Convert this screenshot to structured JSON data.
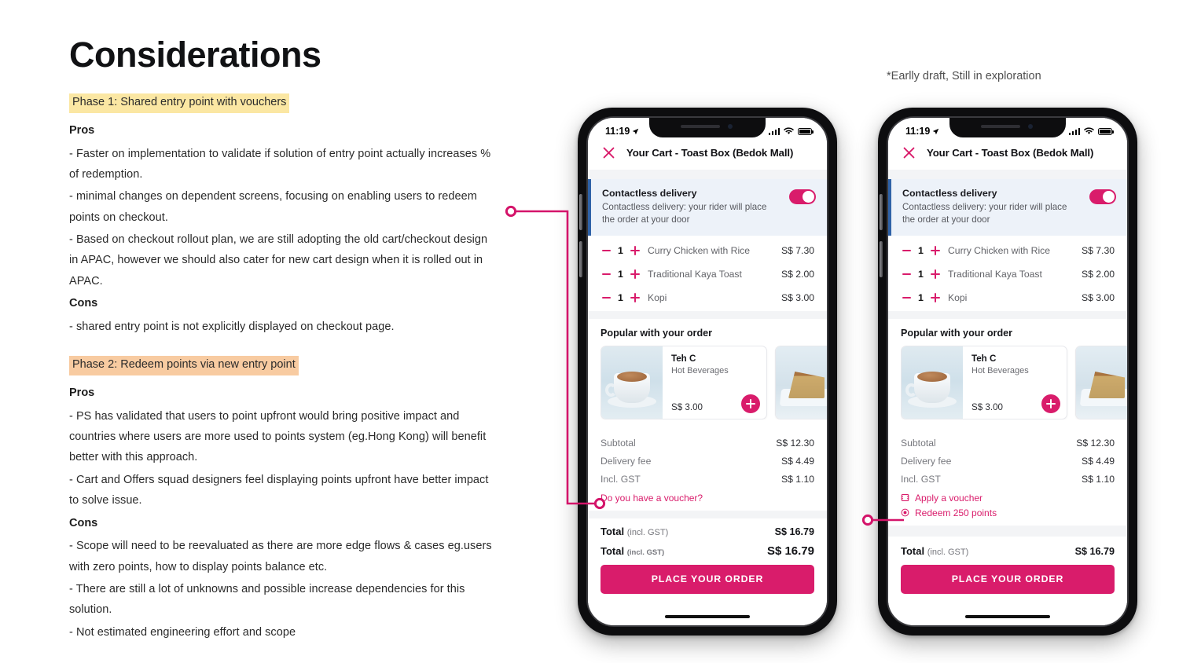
{
  "page": {
    "title": "Considerations",
    "draft_note": "*Earlly draft, Still in exploration",
    "accent_pink": "#D91C6B",
    "highlight_yellow": "#FBE7A3",
    "highlight_orange": "#F8CBA1",
    "banner_blue": "#2F62A8"
  },
  "phase1": {
    "label": "Phase 1: Shared entry point with vouchers",
    "pros_heading": "Pros",
    "pros": [
      "- Faster on implementation to validate if solution of entry point actually increases % of redemption.",
      "- minimal changes on dependent screens, focusing on enabling users to redeem points on checkout.",
      "- Based on checkout rollout plan, we are still adopting the old cart/checkout design in APAC, however we should also cater for new cart design when it is rolled out in APAC."
    ],
    "cons_heading": "Cons",
    "cons": [
      "-  shared entry point is not explicitly displayed on checkout page."
    ]
  },
  "phase2": {
    "label": "Phase 2: Redeem points via new entry point",
    "pros_heading": "Pros",
    "pros": [
      "- PS has validated that users to point upfront would bring positive impact and countries where users are more used to points system (eg.Hong Kong) will benefit better with this approach.",
      "- Cart and Offers squad designers feel displaying points upfront have better impact to solve issue."
    ],
    "cons_heading": "Cons",
    "cons": [
      "- Scope will need to be reevaluated as there are more edge flows & cases eg.users with zero points, how to display points balance etc.",
      "- There are still a lot of unknowns and possible increase dependencies for this solution.",
      "- Not estimated engineering effort and scope"
    ]
  },
  "phone1": {
    "status": {
      "time": "11:19",
      "location_icon": "location-arrow-icon",
      "signal_icon": "cellular-signal-icon",
      "wifi_icon": "wifi-icon",
      "battery_icon": "battery-icon"
    },
    "header": {
      "close_icon": "close-x-icon",
      "title": "Your Cart - Toast Box (Bedok Mall)"
    },
    "contactless": {
      "title": "Contactless delivery",
      "desc": "Contactless delivery: your rider will place the order at your door",
      "toggle_on": "true"
    },
    "items": [
      {
        "qty": "1",
        "name": "Curry Chicken with Rice",
        "price": "S$ 7.30"
      },
      {
        "qty": "1",
        "name": "Traditional Kaya Toast",
        "price": "S$ 2.00"
      },
      {
        "qty": "1",
        "name": "Kopi",
        "price": "S$ 3.00"
      }
    ],
    "popular": {
      "title": "Popular with your order",
      "cards": [
        {
          "name": "Teh C",
          "category": "Hot Beverages",
          "price": "S$ 3.00",
          "image": "hot-tea-cup-image"
        },
        {
          "name": "",
          "category": "",
          "price": "",
          "image": "cake-slice-image"
        }
      ]
    },
    "summary": [
      {
        "label": "Subtotal",
        "value": "S$ 12.30"
      },
      {
        "label": "Delivery fee",
        "value": "S$ 4.49"
      },
      {
        "label": "Incl. GST",
        "value": "S$ 1.10"
      }
    ],
    "voucher_link": "Do you have a voucher?",
    "total_row_1": {
      "label": "Total",
      "sub": "(incl. GST)",
      "value": "S$ 16.79"
    },
    "total_row_2": {
      "label": "Total",
      "sub": "(incl. GST)",
      "value": "S$ 16.79"
    },
    "cta": "PLACE YOUR ORDER"
  },
  "phone2": {
    "status": {
      "time": "11:19",
      "location_icon": "location-arrow-icon",
      "signal_icon": "cellular-signal-icon",
      "wifi_icon": "wifi-icon",
      "battery_icon": "battery-icon"
    },
    "header": {
      "close_icon": "close-x-icon",
      "title": "Your Cart - Toast Box (Bedok Mall)"
    },
    "contactless": {
      "title": "Contactless delivery",
      "desc": "Contactless delivery: your rider will place the order at your door",
      "toggle_on": "true"
    },
    "items": [
      {
        "qty": "1",
        "name": "Curry Chicken with Rice",
        "price": "S$ 7.30"
      },
      {
        "qty": "1",
        "name": "Traditional Kaya Toast",
        "price": "S$ 2.00"
      },
      {
        "qty": "1",
        "name": "Kopi",
        "price": "S$ 3.00"
      }
    ],
    "popular": {
      "title": "Popular with your order",
      "cards": [
        {
          "name": "Teh C",
          "category": "Hot Beverages",
          "price": "S$ 3.00",
          "image": "hot-tea-cup-image"
        },
        {
          "name": "",
          "category": "",
          "price": "",
          "image": "cake-slice-image"
        }
      ]
    },
    "summary": [
      {
        "label": "Subtotal",
        "value": "S$ 12.30"
      },
      {
        "label": "Delivery fee",
        "value": "S$ 4.49"
      },
      {
        "label": "Incl. GST",
        "value": "S$ 1.10"
      }
    ],
    "voucher_link": "Apply a voucher",
    "points_link": "Redeem 250 points",
    "total_row_1": {
      "label": "Total",
      "sub": "(incl. GST)",
      "value": "S$ 16.79"
    },
    "cta": "PLACE YOUR ORDER"
  }
}
